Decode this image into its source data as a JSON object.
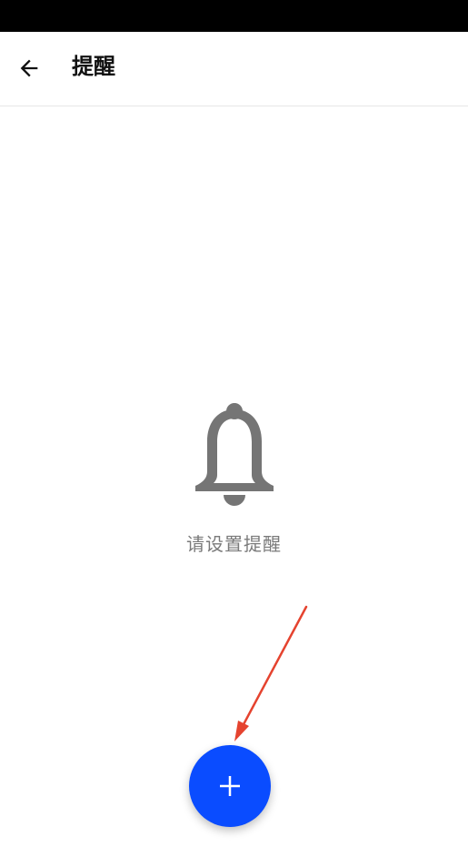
{
  "status_bar": {},
  "app_bar": {
    "back_icon": "arrow-left-icon",
    "title": "提醒"
  },
  "empty_state": {
    "icon": "bell-icon",
    "message": "请设置提醒"
  },
  "fab": {
    "icon": "plus-icon",
    "color": "#0A4CFF"
  },
  "annotation": {
    "arrow_color": "#E5432F"
  }
}
